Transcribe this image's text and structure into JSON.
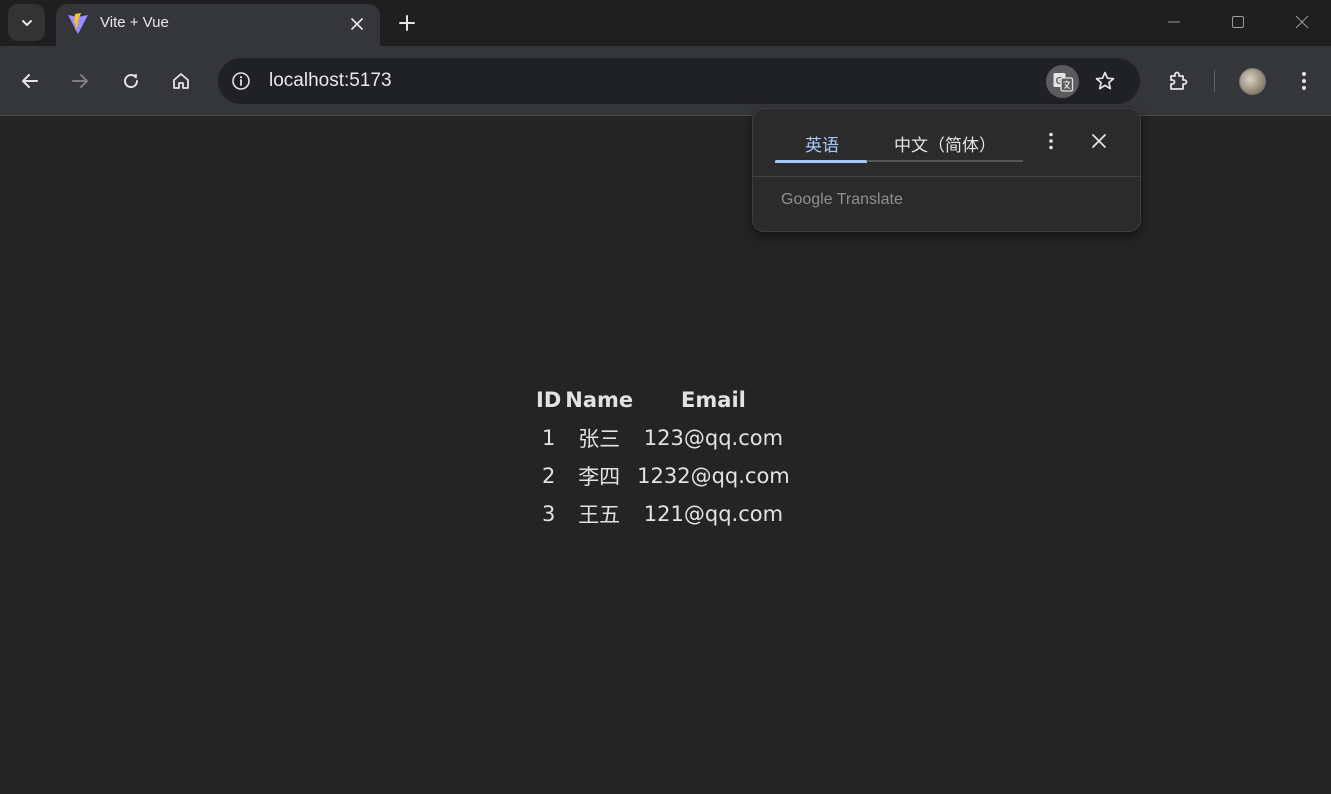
{
  "tabstrip": {
    "tab": {
      "title": "Vite + Vue"
    }
  },
  "toolbar": {
    "url": "localhost:5173"
  },
  "translate_popup": {
    "source_language": "英语",
    "target_language": "中文（简体）",
    "brand_google": "Google",
    "brand_translate": "Translate"
  },
  "table": {
    "headers": [
      "ID",
      "Name",
      "Email"
    ],
    "rows": [
      [
        "1",
        "张三",
        "123@qq.com"
      ],
      [
        "2",
        "李四",
        "1232@qq.com"
      ],
      [
        "3",
        "王五",
        "121@qq.com"
      ]
    ]
  },
  "colors": {
    "page_background": "#242424",
    "accent_tab": "#a8c7fa"
  },
  "icons": {
    "tab_search": "chevron-down-icon",
    "favicon": "vite-logo-icon",
    "tab_close": "close-icon",
    "new_tab": "plus-icon",
    "minimize": "minimize-icon",
    "maximize": "maximize-icon",
    "window_close": "close-icon",
    "back": "arrow-left-icon",
    "forward": "arrow-right-icon",
    "reload": "reload-icon",
    "home": "home-icon",
    "site_info": "info-icon",
    "translate": "translate-icon",
    "bookmark": "star-icon",
    "extensions": "puzzle-icon",
    "menu": "kebab-menu-icon"
  }
}
